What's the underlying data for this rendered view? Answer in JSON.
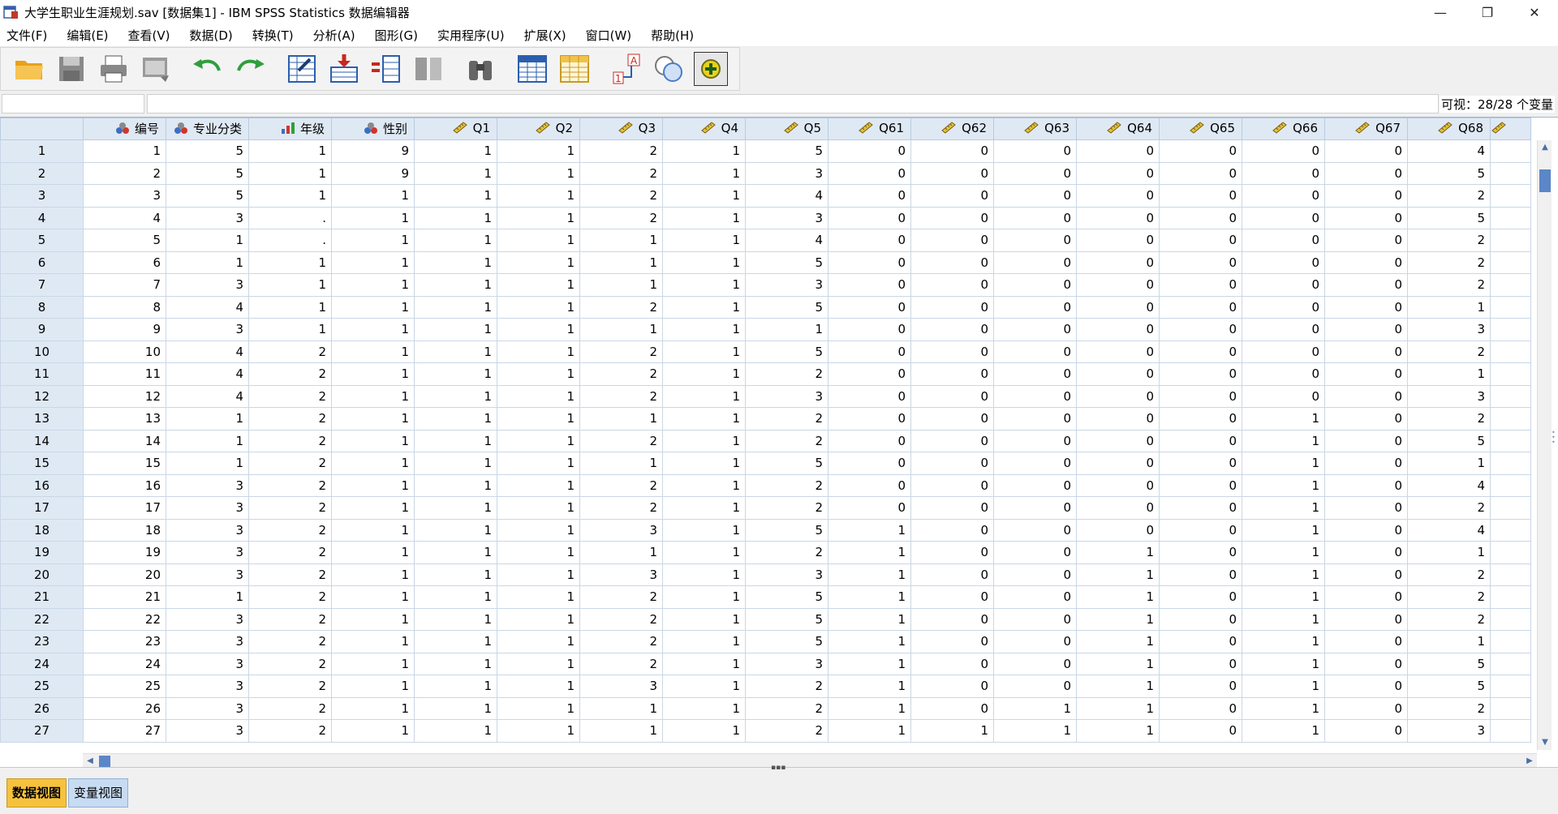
{
  "window": {
    "title": "大学生职业生涯规划.sav [数据集1] - IBM SPSS Statistics 数据编辑器",
    "controls": {
      "minimize": "—",
      "restore": "❐",
      "close": "✕"
    }
  },
  "menu": [
    "文件(F)",
    "编辑(E)",
    "查看(V)",
    "数据(D)",
    "转换(T)",
    "分析(A)",
    "图形(G)",
    "实用程序(U)",
    "扩展(X)",
    "窗口(W)",
    "帮助(H)"
  ],
  "toolbar": {
    "icons": [
      "open-folder-icon",
      "save-disk-icon",
      "print-icon",
      "recall-dialog-icon",
      "undo-icon",
      "redo-icon",
      "goto-case-icon",
      "insert-case-icon",
      "insert-variable-icon",
      "split-file-icon",
      "find-binoculars-icon",
      "variables-icon",
      "value-labels-icon",
      "weight-cases-icon",
      "use-sets-icon",
      "custom-dialog-icon"
    ]
  },
  "editor": {
    "cell_ref": "",
    "cell_value": "",
    "visible_count": "可视：28/28 个变量"
  },
  "columns": [
    {
      "name": "编号",
      "icon": "nominal-icon"
    },
    {
      "name": "专业分类",
      "icon": "nominal-icon"
    },
    {
      "name": "年级",
      "icon": "ordinal-icon"
    },
    {
      "name": "性别",
      "icon": "nominal-icon"
    },
    {
      "name": "Q1",
      "icon": "scale-icon"
    },
    {
      "name": "Q2",
      "icon": "scale-icon"
    },
    {
      "name": "Q3",
      "icon": "scale-icon"
    },
    {
      "name": "Q4",
      "icon": "scale-icon"
    },
    {
      "name": "Q5",
      "icon": "scale-icon"
    },
    {
      "name": "Q61",
      "icon": "scale-icon"
    },
    {
      "name": "Q62",
      "icon": "scale-icon"
    },
    {
      "name": "Q63",
      "icon": "scale-icon"
    },
    {
      "name": "Q64",
      "icon": "scale-icon"
    },
    {
      "name": "Q65",
      "icon": "scale-icon"
    },
    {
      "name": "Q66",
      "icon": "scale-icon"
    },
    {
      "name": "Q67",
      "icon": "scale-icon"
    },
    {
      "name": "Q68",
      "icon": "scale-icon"
    },
    {
      "name": "",
      "icon": "scale-icon"
    }
  ],
  "rows": [
    [
      "1",
      "1",
      "5",
      "1",
      "9",
      "1",
      "1",
      "2",
      "1",
      "5",
      "0",
      "0",
      "0",
      "0",
      "0",
      "0",
      "0",
      "4",
      ""
    ],
    [
      "2",
      "2",
      "5",
      "1",
      "9",
      "1",
      "1",
      "2",
      "1",
      "3",
      "0",
      "0",
      "0",
      "0",
      "0",
      "0",
      "0",
      "5",
      ""
    ],
    [
      "3",
      "3",
      "5",
      "1",
      "1",
      "1",
      "1",
      "2",
      "1",
      "4",
      "0",
      "0",
      "0",
      "0",
      "0",
      "0",
      "0",
      "2",
      ""
    ],
    [
      "4",
      "4",
      "3",
      ".",
      "1",
      "1",
      "1",
      "2",
      "1",
      "3",
      "0",
      "0",
      "0",
      "0",
      "0",
      "0",
      "0",
      "5",
      ""
    ],
    [
      "5",
      "5",
      "1",
      ".",
      "1",
      "1",
      "1",
      "1",
      "1",
      "4",
      "0",
      "0",
      "0",
      "0",
      "0",
      "0",
      "0",
      "2",
      ""
    ],
    [
      "6",
      "6",
      "1",
      "1",
      "1",
      "1",
      "1",
      "1",
      "1",
      "5",
      "0",
      "0",
      "0",
      "0",
      "0",
      "0",
      "0",
      "2",
      ""
    ],
    [
      "7",
      "7",
      "3",
      "1",
      "1",
      "1",
      "1",
      "1",
      "1",
      "3",
      "0",
      "0",
      "0",
      "0",
      "0",
      "0",
      "0",
      "2",
      ""
    ],
    [
      "8",
      "8",
      "4",
      "1",
      "1",
      "1",
      "1",
      "2",
      "1",
      "5",
      "0",
      "0",
      "0",
      "0",
      "0",
      "0",
      "0",
      "1",
      ""
    ],
    [
      "9",
      "9",
      "3",
      "1",
      "1",
      "1",
      "1",
      "1",
      "1",
      "1",
      "0",
      "0",
      "0",
      "0",
      "0",
      "0",
      "0",
      "3",
      ""
    ],
    [
      "10",
      "10",
      "4",
      "2",
      "1",
      "1",
      "1",
      "2",
      "1",
      "5",
      "0",
      "0",
      "0",
      "0",
      "0",
      "0",
      "0",
      "2",
      ""
    ],
    [
      "11",
      "11",
      "4",
      "2",
      "1",
      "1",
      "1",
      "2",
      "1",
      "2",
      "0",
      "0",
      "0",
      "0",
      "0",
      "0",
      "0",
      "1",
      ""
    ],
    [
      "12",
      "12",
      "4",
      "2",
      "1",
      "1",
      "1",
      "2",
      "1",
      "3",
      "0",
      "0",
      "0",
      "0",
      "0",
      "0",
      "0",
      "3",
      ""
    ],
    [
      "13",
      "13",
      "1",
      "2",
      "1",
      "1",
      "1",
      "1",
      "1",
      "2",
      "0",
      "0",
      "0",
      "0",
      "0",
      "1",
      "0",
      "2",
      ""
    ],
    [
      "14",
      "14",
      "1",
      "2",
      "1",
      "1",
      "1",
      "2",
      "1",
      "2",
      "0",
      "0",
      "0",
      "0",
      "0",
      "1",
      "0",
      "5",
      ""
    ],
    [
      "15",
      "15",
      "1",
      "2",
      "1",
      "1",
      "1",
      "1",
      "1",
      "5",
      "0",
      "0",
      "0",
      "0",
      "0",
      "1",
      "0",
      "1",
      ""
    ],
    [
      "16",
      "16",
      "3",
      "2",
      "1",
      "1",
      "1",
      "2",
      "1",
      "2",
      "0",
      "0",
      "0",
      "0",
      "0",
      "1",
      "0",
      "4",
      ""
    ],
    [
      "17",
      "17",
      "3",
      "2",
      "1",
      "1",
      "1",
      "2",
      "1",
      "2",
      "0",
      "0",
      "0",
      "0",
      "0",
      "1",
      "0",
      "2",
      ""
    ],
    [
      "18",
      "18",
      "3",
      "2",
      "1",
      "1",
      "1",
      "3",
      "1",
      "5",
      "1",
      "0",
      "0",
      "0",
      "0",
      "1",
      "0",
      "4",
      ""
    ],
    [
      "19",
      "19",
      "3",
      "2",
      "1",
      "1",
      "1",
      "1",
      "1",
      "2",
      "1",
      "0",
      "0",
      "1",
      "0",
      "1",
      "0",
      "1",
      ""
    ],
    [
      "20",
      "20",
      "3",
      "2",
      "1",
      "1",
      "1",
      "3",
      "1",
      "3",
      "1",
      "0",
      "0",
      "1",
      "0",
      "1",
      "0",
      "2",
      ""
    ],
    [
      "21",
      "21",
      "1",
      "2",
      "1",
      "1",
      "1",
      "2",
      "1",
      "5",
      "1",
      "0",
      "0",
      "1",
      "0",
      "1",
      "0",
      "2",
      ""
    ],
    [
      "22",
      "22",
      "3",
      "2",
      "1",
      "1",
      "1",
      "2",
      "1",
      "5",
      "1",
      "0",
      "0",
      "1",
      "0",
      "1",
      "0",
      "2",
      ""
    ],
    [
      "23",
      "23",
      "3",
      "2",
      "1",
      "1",
      "1",
      "2",
      "1",
      "5",
      "1",
      "0",
      "0",
      "1",
      "0",
      "1",
      "0",
      "1",
      ""
    ],
    [
      "24",
      "24",
      "3",
      "2",
      "1",
      "1",
      "1",
      "2",
      "1",
      "3",
      "1",
      "0",
      "0",
      "1",
      "0",
      "1",
      "0",
      "5",
      ""
    ],
    [
      "25",
      "25",
      "3",
      "2",
      "1",
      "1",
      "1",
      "3",
      "1",
      "2",
      "1",
      "0",
      "0",
      "1",
      "0",
      "1",
      "0",
      "5",
      ""
    ],
    [
      "26",
      "26",
      "3",
      "2",
      "1",
      "1",
      "1",
      "1",
      "1",
      "2",
      "1",
      "0",
      "1",
      "1",
      "0",
      "1",
      "0",
      "2",
      ""
    ],
    [
      "27",
      "27",
      "3",
      "2",
      "1",
      "1",
      "1",
      "1",
      "1",
      "2",
      "1",
      "1",
      "1",
      "1",
      "0",
      "1",
      "0",
      "3",
      ""
    ]
  ],
  "tabs": {
    "data_view": "数据视图",
    "variable_view": "变量视图"
  }
}
